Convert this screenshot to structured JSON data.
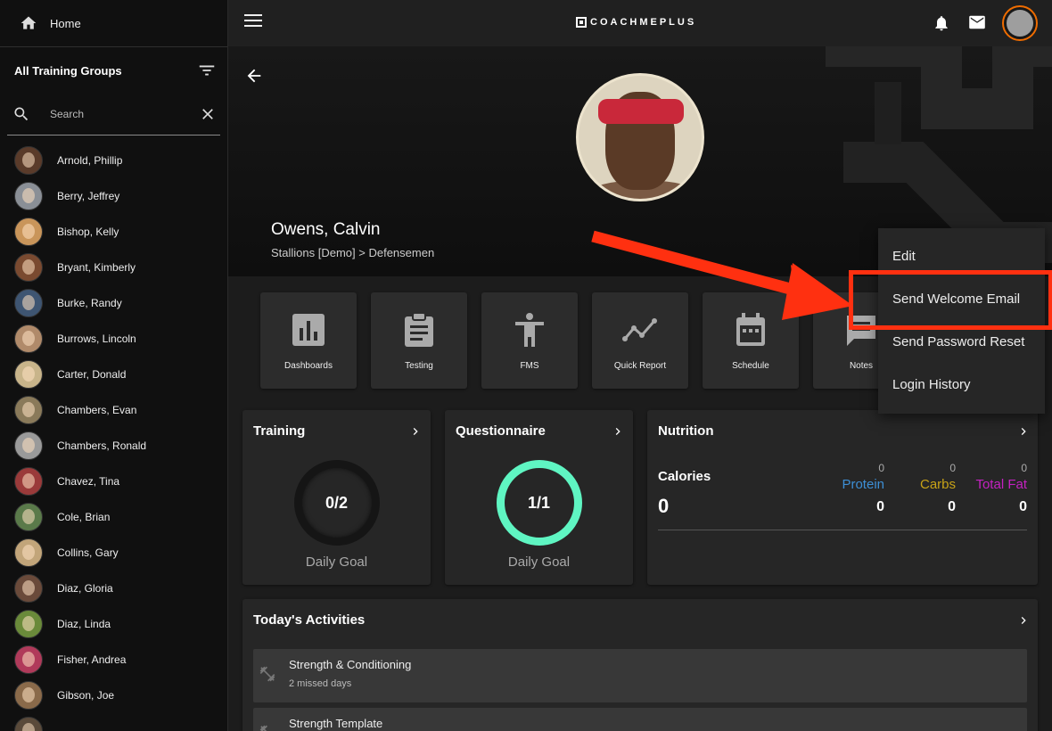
{
  "sidebar": {
    "home_label": "Home",
    "groups_label": "All Training Groups",
    "search_placeholder": "Search",
    "athletes": [
      {
        "name": "Arnold, Phillip",
        "color": "#5a3b2a"
      },
      {
        "name": "Berry, Jeffrey",
        "color": "#8a8f96"
      },
      {
        "name": "Bishop, Kelly",
        "color": "#c9955a"
      },
      {
        "name": "Bryant, Kimberly",
        "color": "#7a4a30"
      },
      {
        "name": "Burke, Randy",
        "color": "#3e5572"
      },
      {
        "name": "Burrows, Lincoln",
        "color": "#b08a6a"
      },
      {
        "name": "Carter, Donald",
        "color": "#c8b48a"
      },
      {
        "name": "Chambers, Evan",
        "color": "#8a7a5a"
      },
      {
        "name": "Chambers, Ronald",
        "color": "#9a9a9a"
      },
      {
        "name": "Chavez, Tina",
        "color": "#9a3a3a"
      },
      {
        "name": "Cole, Brian",
        "color": "#5a7a4a"
      },
      {
        "name": "Collins, Gary",
        "color": "#c2a57a"
      },
      {
        "name": "Diaz, Gloria",
        "color": "#6a4a3a"
      },
      {
        "name": "Diaz, Linda",
        "color": "#6a8a3a"
      },
      {
        "name": "Fisher, Andrea",
        "color": "#b03a5a"
      },
      {
        "name": "Gibson, Joe",
        "color": "#8a6a4a"
      },
      {
        "name": "",
        "color": "#5a4a3a"
      }
    ]
  },
  "topbar": {
    "logo_text": "COACHMEPLUS"
  },
  "profile": {
    "name": "Owens, Calvin",
    "team_path": "Stallions [Demo] > Defensemen"
  },
  "tiles": [
    {
      "label": "Dashboards",
      "icon": "bar-chart-icon"
    },
    {
      "label": "Testing",
      "icon": "clipboard-icon"
    },
    {
      "label": "FMS",
      "icon": "human-figure-icon"
    },
    {
      "label": "Quick Report",
      "icon": "trending-line-icon"
    },
    {
      "label": "Schedule",
      "icon": "calendar-icon"
    },
    {
      "label": "Notes",
      "icon": "comment-icon"
    }
  ],
  "training": {
    "title": "Training",
    "value": "0/2",
    "goal_label": "Daily Goal",
    "progress": 0
  },
  "questionnaire": {
    "title": "Questionnaire",
    "value": "1/1",
    "goal_label": "Daily Goal",
    "progress": 1,
    "ring_color": "#5ff5c2"
  },
  "nutrition": {
    "title": "Nutrition",
    "calories_label": "Calories",
    "calories_value": "0",
    "macros": [
      {
        "label": "Protein",
        "goal": "0",
        "value": "0",
        "color": "#3d8fd6"
      },
      {
        "label": "Carbs",
        "goal": "0",
        "value": "0",
        "color": "#c7a217"
      },
      {
        "label": "Total Fat",
        "goal": "0",
        "value": "0",
        "color": "#c421c1"
      }
    ]
  },
  "activities": {
    "title": "Today's Activities",
    "items": [
      {
        "name": "Strength & Conditioning",
        "sub": "2 missed days"
      },
      {
        "name": "Strength Template",
        "sub": ""
      }
    ]
  },
  "menu": {
    "items": [
      "Edit",
      "Send Welcome Email",
      "Send Password Reset",
      "Login History"
    ]
  },
  "colors": {
    "accent_orange": "#ef6c00",
    "annotation_red": "#ff3010"
  }
}
